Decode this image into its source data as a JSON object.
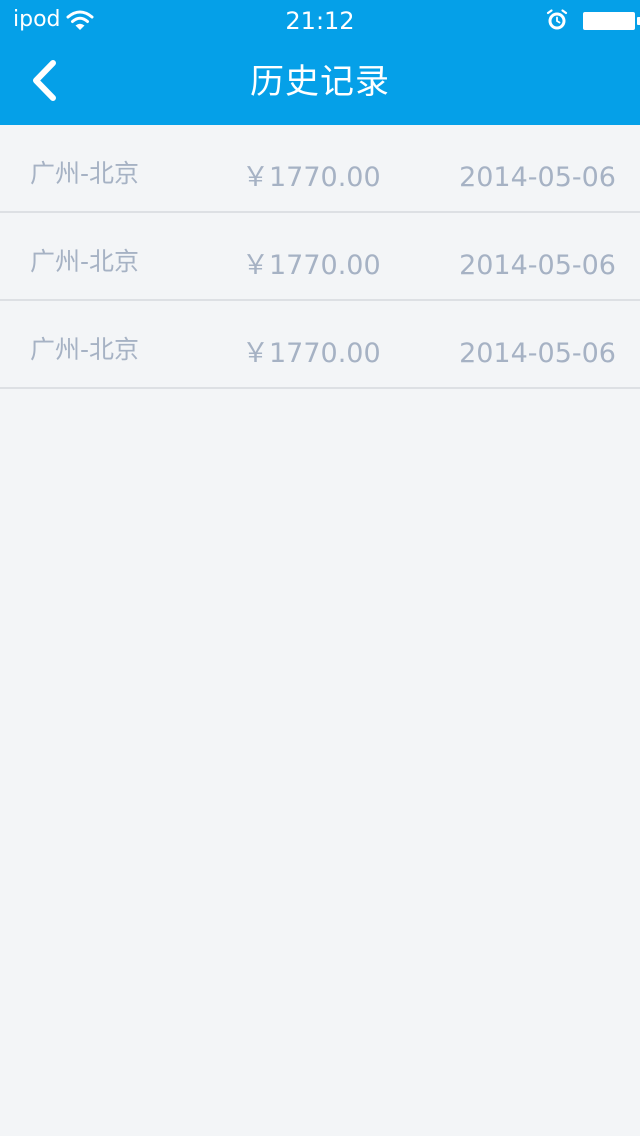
{
  "status_bar": {
    "carrier": "ipod",
    "time": "21:12",
    "wifi_icon": "wifi-icon",
    "alarm_icon": "alarm-icon",
    "battery_icon": "battery-icon"
  },
  "nav": {
    "title": "历史记录",
    "back_icon": "chevron-left-icon"
  },
  "records": [
    {
      "route": "广州-北京",
      "price": "￥1770.00",
      "date": "2014-05-06"
    },
    {
      "route": "广州-北京",
      "price": "￥1770.00",
      "date": "2014-05-06"
    },
    {
      "route": "广州-北京",
      "price": "￥1770.00",
      "date": "2014-05-06"
    }
  ],
  "colors": {
    "header": "#05a0e8",
    "background": "#f3f5f7",
    "row_text": "#a6b2c4",
    "divider": "#dde0e4"
  }
}
